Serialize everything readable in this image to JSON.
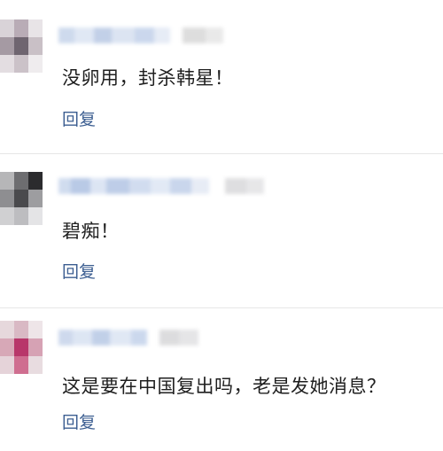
{
  "comments": [
    {
      "text": "没卵用，封杀韩星！",
      "reply_label": "回复"
    },
    {
      "text": "碧痴！",
      "reply_label": "回复"
    },
    {
      "text": "这是要在中国复出吗，老是发她消息？",
      "reply_label": "回复"
    }
  ],
  "colors": {
    "reply_link": "#3c5e91",
    "comment_text": "#1f1f1f",
    "divider": "#e6e6e6",
    "background": "#ffffff"
  },
  "icons": {
    "avatar": "pixelated-avatar-icon"
  }
}
